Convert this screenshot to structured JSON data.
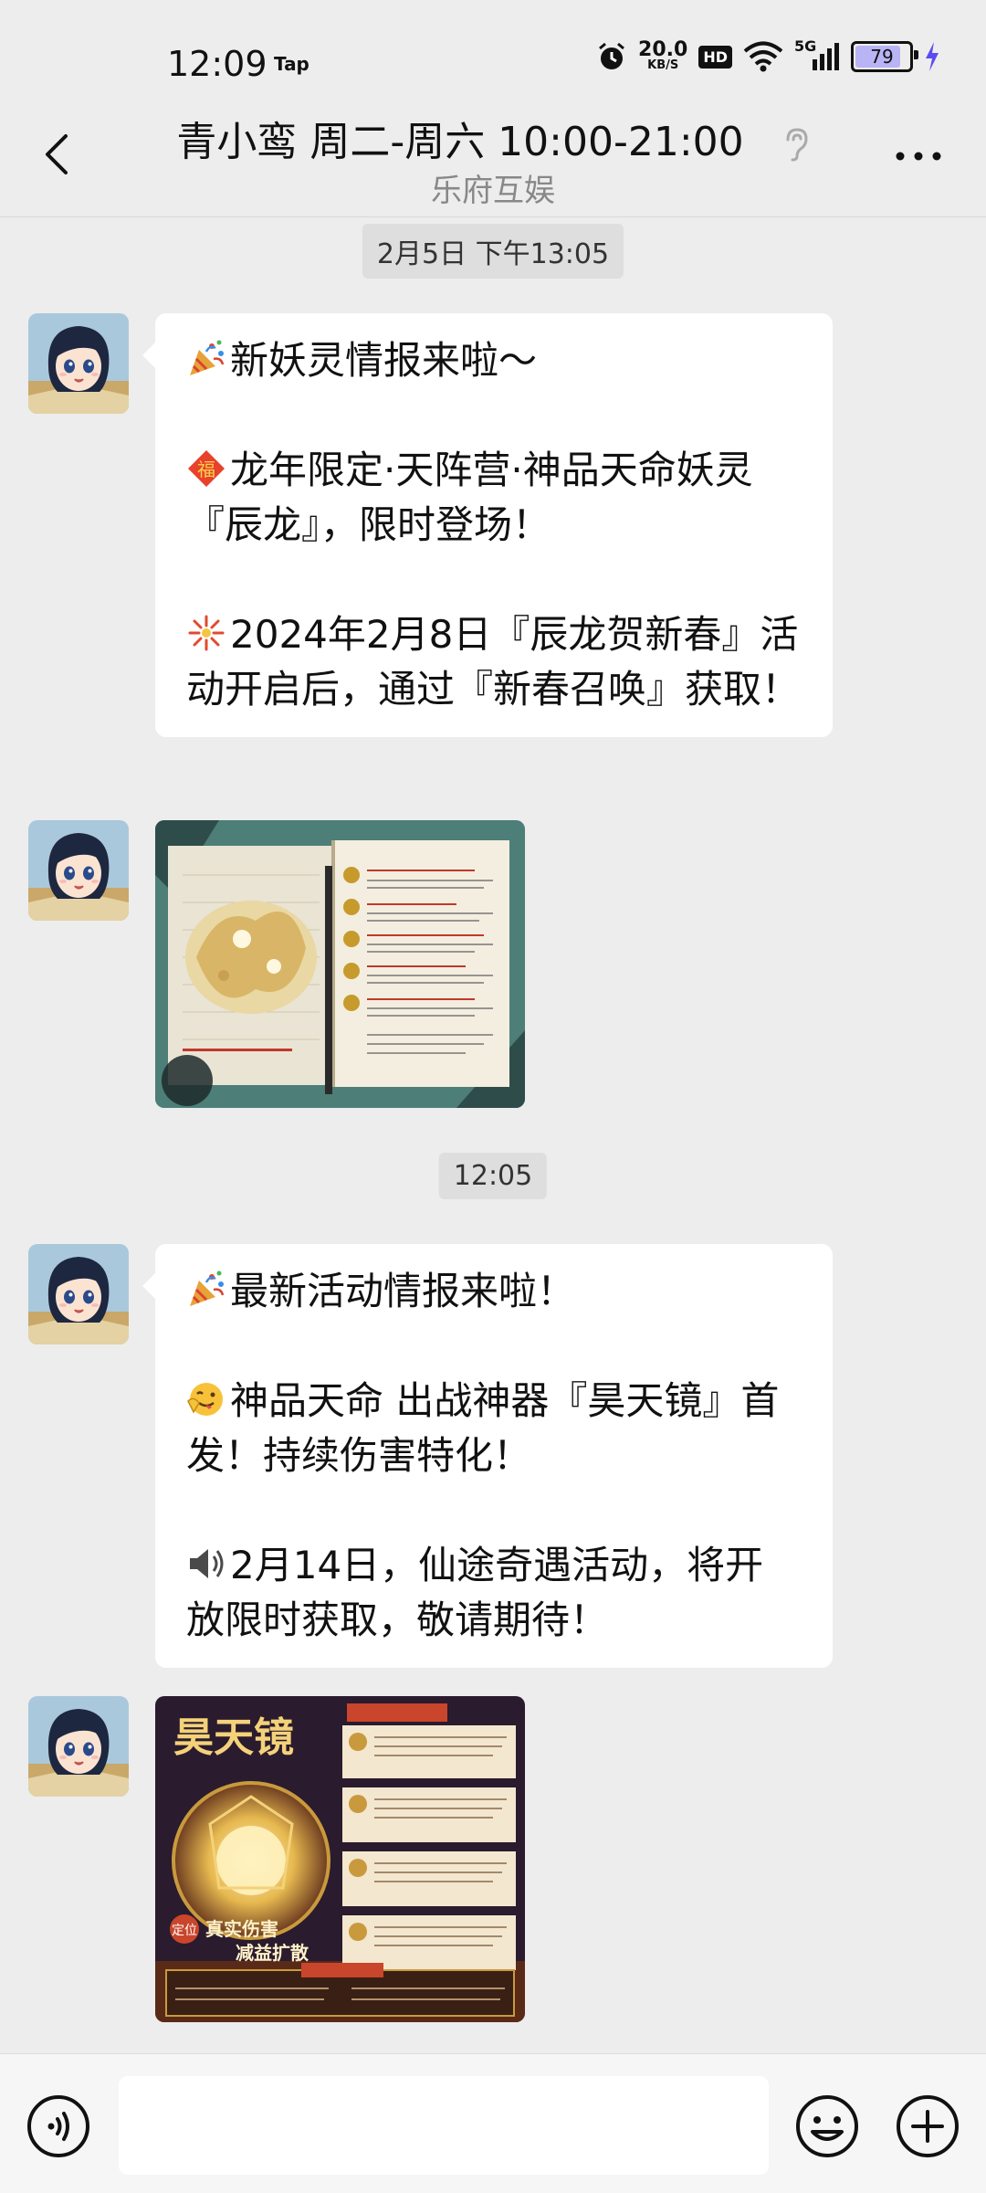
{
  "status": {
    "time": "12:09",
    "tap": "Tap",
    "net_speed_value": "20.0",
    "net_speed_unit": "KB/S",
    "hd": "HD",
    "signal": "5G",
    "battery": "79"
  },
  "header": {
    "title": "青小鸾 周二-周六 10:00-21:00",
    "subtitle": "乐府互娱"
  },
  "timestamps": [
    "2月5日 下午13:05",
    "12:05"
  ],
  "messages": [
    {
      "paragraphs": [
        "新妖灵情报来啦～",
        "龙年限定·天阵营·神品天命妖灵『辰龙』，限时登场！",
        "2024年2月8日『辰龙贺新春』活动开启后，通过『新春召唤』获取！"
      ],
      "icons": [
        "party-popper-icon",
        "fu-diamond-icon",
        "firecracker-icon"
      ]
    },
    {
      "paragraphs": [
        "最新活动情报来啦！",
        "神品天命 出战神器『昊天镜』首发！持续伤害特化！",
        "2月14日，仙途奇遇活动，将开放限时获取，敬请期待！"
      ],
      "icons": [
        "party-popper-icon",
        "wink-tongue-icon",
        "speaker-icon"
      ]
    }
  ],
  "image2_text": {
    "title": "昊天镜",
    "tag": "定位",
    "slogan_line1": "真实伤害",
    "slogan_line2": "减益扩散"
  },
  "colors": {
    "background": "#ededed",
    "bubble": "#ffffff",
    "timestamp_bg": "#dedede",
    "battery_fill": "#b9b4f5",
    "charging": "#5a4cf0"
  }
}
